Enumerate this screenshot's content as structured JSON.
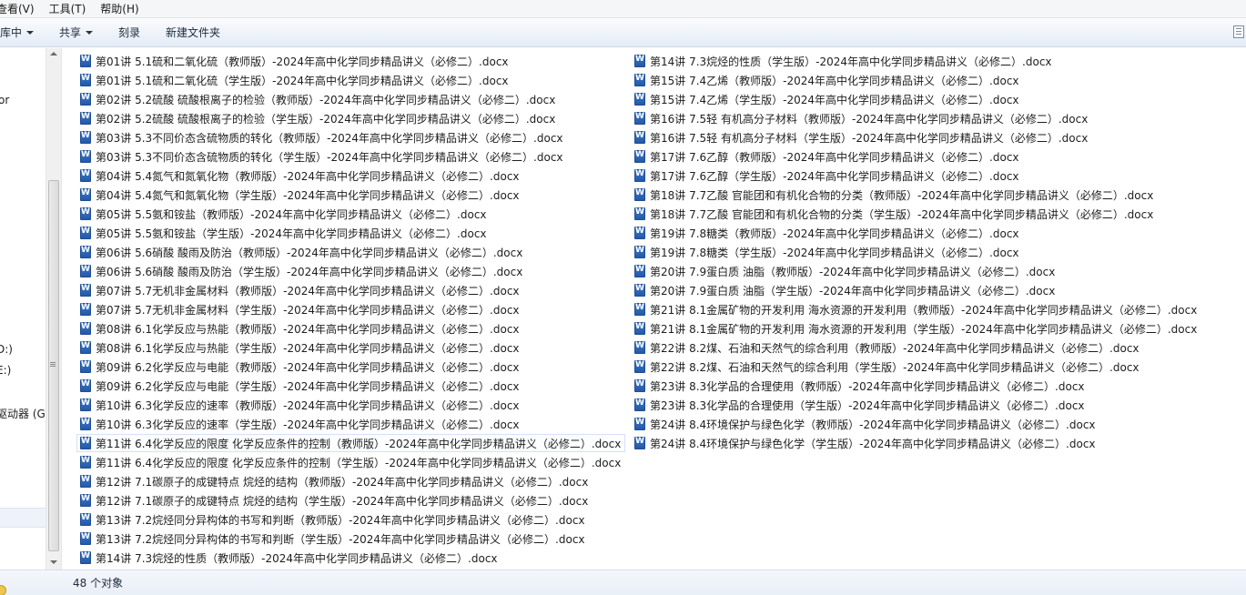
{
  "menu": [
    "查看(V)",
    "工具(T)",
    "帮助(H)"
  ],
  "toolbar": {
    "library": "库中",
    "share": "共享",
    "burn": "刻录",
    "new_folder": "新建文件夹"
  },
  "nav": [
    "or",
    "D:)",
    "E:)",
    "驱动器 (G:"
  ],
  "files": [
    "第01讲 5.1硫和二氧化硫（教师版）-2024年高中化学同步精品讲义（必修二）.docx",
    "第01讲 5.1硫和二氧化硫（学生版）-2024年高中化学同步精品讲义（必修二）.docx",
    "第02讲 5.2硫酸 硫酸根离子的检验（教师版）-2024年高中化学同步精品讲义（必修二）.docx",
    "第02讲 5.2硫酸 硫酸根离子的检验（学生版）-2024年高中化学同步精品讲义（必修二）.docx",
    "第03讲 5.3不同价态含硫物质的转化（教师版）-2024年高中化学同步精品讲义（必修二）.docx",
    "第03讲 5.3不同价态含硫物质的转化（学生版）-2024年高中化学同步精品讲义（必修二）.docx",
    "第04讲 5.4氮气和氮氧化物（教师版）-2024年高中化学同步精品讲义（必修二）.docx",
    "第04讲 5.4氮气和氮氧化物（学生版）-2024年高中化学同步精品讲义（必修二）.docx",
    "第05讲 5.5氨和铵盐（教师版）-2024年高中化学同步精品讲义（必修二）.docx",
    "第05讲 5.5氨和铵盐（学生版）-2024年高中化学同步精品讲义（必修二）.docx",
    "第06讲 5.6硝酸 酸雨及防治（教师版）-2024年高中化学同步精品讲义（必修二）.docx",
    "第06讲 5.6硝酸 酸雨及防治（学生版）-2024年高中化学同步精品讲义（必修二）.docx",
    "第07讲 5.7无机非金属材料（教师版）-2024年高中化学同步精品讲义（必修二）.docx",
    "第07讲 5.7无机非金属材料（学生版）-2024年高中化学同步精品讲义（必修二）.docx",
    "第08讲 6.1化学反应与热能（教师版）-2024年高中化学同步精品讲义（必修二）.docx",
    "第08讲 6.1化学反应与热能（学生版）-2024年高中化学同步精品讲义（必修二）.docx",
    "第09讲 6.2化学反应与电能（教师版）-2024年高中化学同步精品讲义（必修二）.docx",
    "第09讲 6.2化学反应与电能（学生版）-2024年高中化学同步精品讲义（必修二）.docx",
    "第10讲 6.3化学反应的速率（教师版）-2024年高中化学同步精品讲义（必修二）.docx",
    "第10讲 6.3化学反应的速率（学生版）-2024年高中化学同步精品讲义（必修二）.docx",
    "第11讲 6.4化学反应的限度 化学反应条件的控制（教师版）-2024年高中化学同步精品讲义（必修二）.docx",
    "第11讲 6.4化学反应的限度 化学反应条件的控制（学生版）-2024年高中化学同步精品讲义（必修二）.docx",
    "第12讲 7.1碳原子的成键特点 烷烃的结构（教师版）-2024年高中化学同步精品讲义（必修二）.docx",
    "第12讲 7.1碳原子的成键特点 烷烃的结构（学生版）-2024年高中化学同步精品讲义（必修二）.docx",
    "第13讲 7.2烷烃同分异构体的书写和判断（教师版）-2024年高中化学同步精品讲义（必修二）.docx",
    "第13讲 7.2烷烃同分异构体的书写和判断（学生版）-2024年高中化学同步精品讲义（必修二）.docx",
    "第14讲 7.3烷烃的性质（教师版）-2024年高中化学同步精品讲义（必修二）.docx",
    "第14讲 7.3烷烃的性质（学生版）-2024年高中化学同步精品讲义（必修二）.docx",
    "第15讲 7.4乙烯（教师版）-2024年高中化学同步精品讲义（必修二）.docx",
    "第15讲 7.4乙烯（学生版）-2024年高中化学同步精品讲义（必修二）.docx",
    "第16讲 7.5轻 有机高分子材料（教师版）-2024年高中化学同步精品讲义（必修二）.docx",
    "第16讲 7.5轻 有机高分子材料（学生版）-2024年高中化学同步精品讲义（必修二）.docx",
    "第17讲 7.6乙醇（教师版）-2024年高中化学同步精品讲义（必修二）.docx",
    "第17讲 7.6乙醇（学生版）-2024年高中化学同步精品讲义（必修二）.docx",
    "第18讲 7.7乙酸 官能团和有机化合物的分类（教师版）-2024年高中化学同步精品讲义（必修二）.docx",
    "第18讲 7.7乙酸 官能团和有机化合物的分类（学生版）-2024年高中化学同步精品讲义（必修二）.docx",
    "第19讲 7.8糖类（教师版）-2024年高中化学同步精品讲义（必修二）.docx",
    "第19讲 7.8糖类（学生版）-2024年高中化学同步精品讲义（必修二）.docx",
    "第20讲 7.9蛋白质 油脂（教师版）-2024年高中化学同步精品讲义（必修二）.docx",
    "第20讲 7.9蛋白质 油脂（学生版）-2024年高中化学同步精品讲义（必修二）.docx",
    "第21讲 8.1金属矿物的开发利用 海水资源的开发利用（教师版）-2024年高中化学同步精品讲义（必修二）.docx",
    "第21讲 8.1金属矿物的开发利用 海水资源的开发利用（学生版）-2024年高中化学同步精品讲义（必修二）.docx",
    "第22讲 8.2煤、石油和天然气的综合利用（教师版）-2024年高中化学同步精品讲义（必修二）.docx",
    "第22讲 8.2煤、石油和天然气的综合利用（学生版）-2024年高中化学同步精品讲义（必修二）.docx",
    "第23讲 8.3化学品的合理使用（教师版）-2024年高中化学同步精品讲义（必修二）.docx",
    "第23讲 8.3化学品的合理使用（学生版）-2024年高中化学同步精品讲义（必修二）.docx",
    "第24讲 8.4环境保护与绿色化学（教师版）-2024年高中化学同步精品讲义（必修二）.docx",
    "第24讲 8.4环境保护与绿色化学（学生版）-2024年高中化学同步精品讲义（必修二）.docx"
  ],
  "focused_index": 20,
  "status": {
    "count": "48 个对象"
  }
}
